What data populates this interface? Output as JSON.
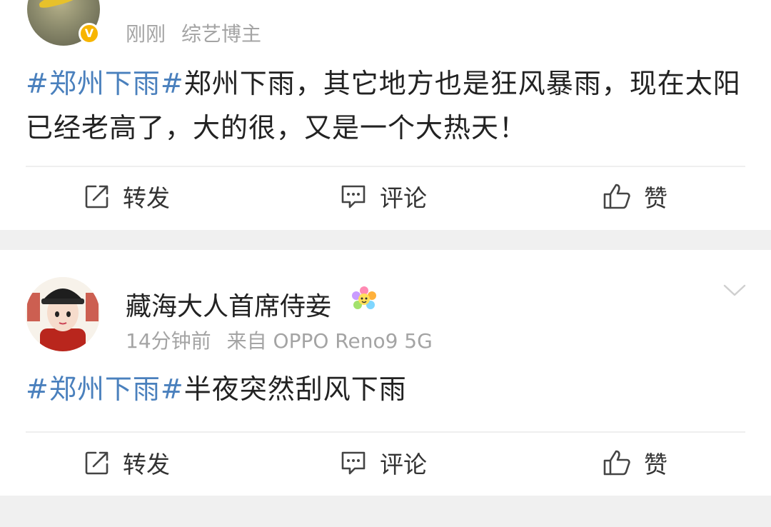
{
  "posts": [
    {
      "time": "刚刚",
      "source": "综艺博主",
      "topic": "#郑州下雨#",
      "text": "郑州下雨，其它地方也是狂风暴雨，现在太阳已经老高了，大的很，又是一个大热天！",
      "actions": {
        "repost": "转发",
        "comment": "评论",
        "like": "赞"
      }
    },
    {
      "username": "藏海大人首席侍妾",
      "time": "14分钟前",
      "source": "来自 OPPO Reno9 5G",
      "topic": "#郑州下雨#",
      "text": "半夜突然刮风下雨",
      "actions": {
        "repost": "转发",
        "comment": "评论",
        "like": "赞"
      }
    }
  ],
  "icons": [
    "verified-v-icon",
    "repost-icon",
    "comment-icon",
    "like-icon",
    "flower-badge-icon",
    "chevron-down-icon"
  ],
  "colors": {
    "topic": "#4a80bd",
    "verified": "#f7b500",
    "meta": "#a4a4a4",
    "background": "#f0f0f0"
  }
}
